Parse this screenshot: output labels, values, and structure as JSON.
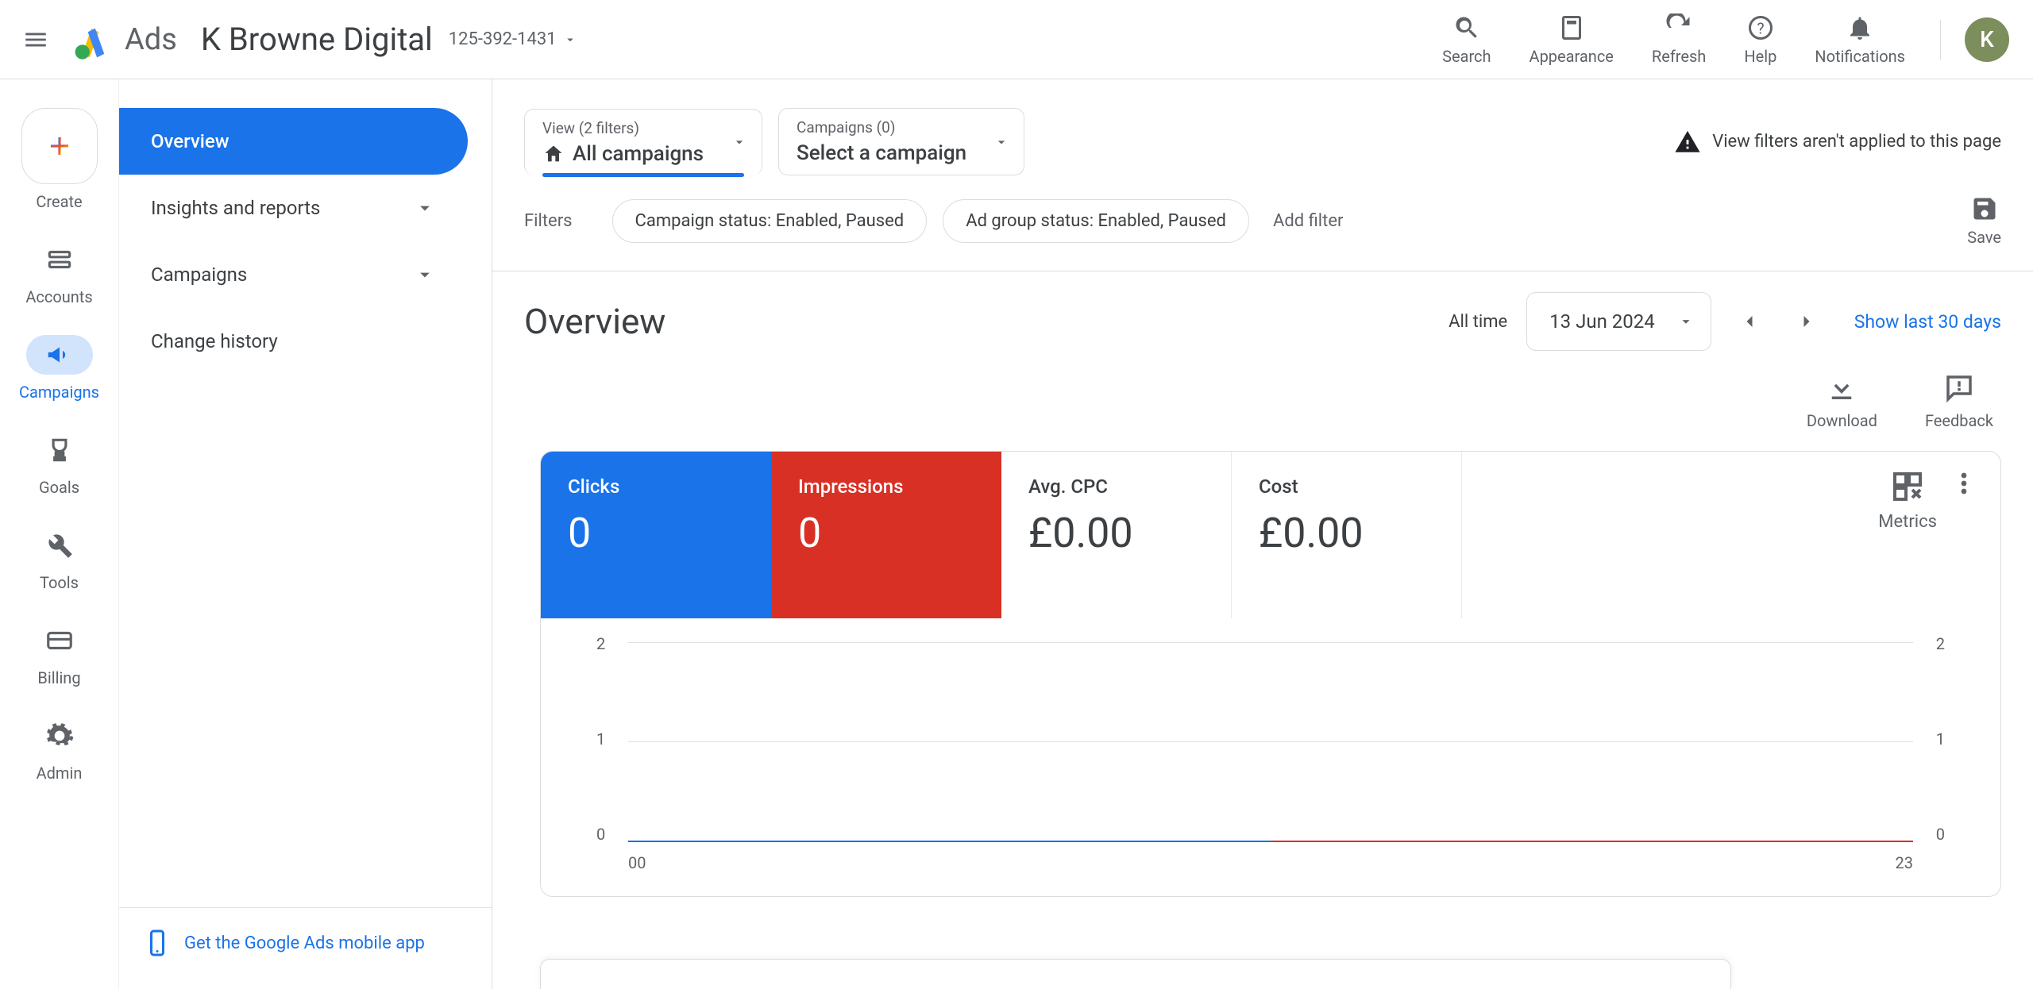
{
  "brand_text": "Ads",
  "account_name": "K Browne Digital",
  "account_id": "125-392-1431",
  "top_actions": {
    "search": "Search",
    "appearance": "Appearance",
    "refresh": "Refresh",
    "help": "Help",
    "notifications": "Notifications"
  },
  "avatar_initial": "K",
  "rail": [
    {
      "key": "create",
      "label": "Create"
    },
    {
      "key": "accounts",
      "label": "Accounts"
    },
    {
      "key": "campaigns",
      "label": "Campaigns"
    },
    {
      "key": "goals",
      "label": "Goals"
    },
    {
      "key": "tools",
      "label": "Tools"
    },
    {
      "key": "billing",
      "label": "Billing"
    },
    {
      "key": "admin",
      "label": "Admin"
    }
  ],
  "sec_nav": {
    "overview": "Overview",
    "insights": "Insights and reports",
    "campaigns": "Campaigns",
    "history": "Change history",
    "footer_link": "Get the Google Ads mobile app"
  },
  "view_filter": {
    "small": "View (2 filters)",
    "big": "All campaigns"
  },
  "campaign_selector": {
    "small": "Campaigns (0)",
    "big": "Select a campaign"
  },
  "warning_text": "View filters aren't applied to this page",
  "filters_label": "Filters",
  "chips": [
    "Campaign status: Enabled, Paused",
    "Ad group status: Enabled, Paused"
  ],
  "add_filter_placeholder": "Add filter",
  "save_label": "Save",
  "overview_title": "Overview",
  "date": {
    "range_label": "All time",
    "value": "13 Jun 2024",
    "show_last": "Show last 30 days"
  },
  "actions": {
    "download": "Download",
    "feedback": "Feedback"
  },
  "metrics": [
    {
      "label": "Clicks",
      "value": "0",
      "style": "blue"
    },
    {
      "label": "Impressions",
      "value": "0",
      "style": "red"
    },
    {
      "label": "Avg. CPC",
      "value": "£0.00",
      "style": "plain"
    },
    {
      "label": "Cost",
      "value": "£0.00",
      "style": "plain"
    }
  ],
  "metrics_button_label": "Metrics",
  "chart_data": {
    "type": "line",
    "title": "",
    "x": [
      "00",
      "23"
    ],
    "ylim_left": [
      0,
      2
    ],
    "ylim_right": [
      0,
      2
    ],
    "y_ticks_left": [
      "2",
      "1",
      "0"
    ],
    "y_ticks_right": [
      "2",
      "1",
      "0"
    ],
    "x_ticks": [
      "00",
      "23"
    ],
    "series": [
      {
        "name": "Clicks",
        "color": "#1a73e8",
        "values": [
          0,
          0
        ]
      },
      {
        "name": "Impressions",
        "color": "#d93025",
        "values": [
          0,
          0
        ]
      }
    ]
  }
}
